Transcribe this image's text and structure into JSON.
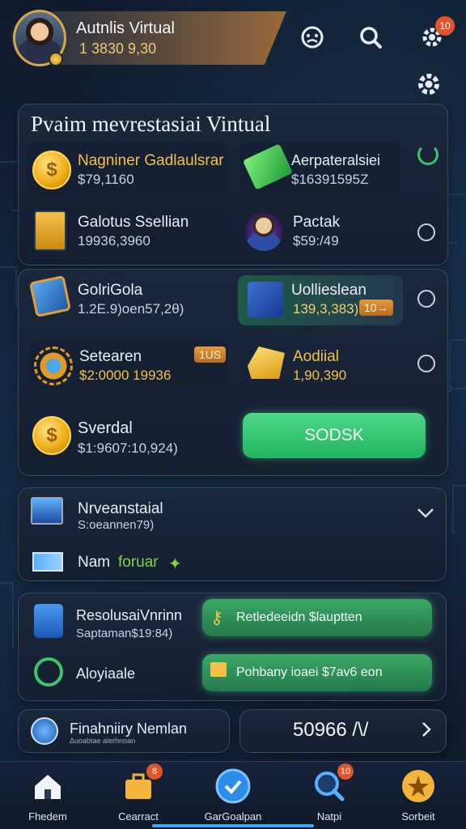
{
  "header": {
    "profile_name": "Autnlis Virtual",
    "profile_balance": "1 3830 9,30",
    "notification_count": "10"
  },
  "main_panel": {
    "title": "Pvaim mevrestasiai Vintual",
    "tiles": [
      {
        "label": "Nagniner Gadlaulsrar",
        "value": "$79,1160"
      },
      {
        "label": "Aerpateralsiei",
        "value": "$16391595Ζ"
      },
      {
        "label": "Galotus Ssellian",
        "value": "19936,3960"
      },
      {
        "label": "Pactak",
        "value": "$59:/49"
      }
    ]
  },
  "wallet_panel": {
    "tiles": [
      {
        "label": "GolriGola",
        "value": "1.2Ε.9)oen57,2θ)"
      },
      {
        "label": "Uollieslean",
        "value": "139,3,383)",
        "badge": "10→"
      },
      {
        "label": "Setearen",
        "value": "$2:0000 19936",
        "badge": "1US"
      },
      {
        "label": "Aodiial",
        "value": "1,90,390"
      },
      {
        "label": "Sverdal",
        "value": "$1:9607:10,924)"
      }
    ],
    "action_button": "SODSK"
  },
  "invest_panel": {
    "title": "Nrveanstaial",
    "subtitle": "S:oeannen79)",
    "row_label": "Nam",
    "row_accent": "foruar"
  },
  "reward_panel": {
    "row1_label": "ResolusaiVnrinn",
    "row1_sub": "Saptaman$19:84)",
    "row1_button": "Retledeeidn $lauptten",
    "row2_label": "Aloyiaale",
    "row2_button": "Pohbany ioaei $7av6 eon"
  },
  "footer_row": {
    "left_title": "Finahniiry Nemlan",
    "left_sub": "Δuoabtae alerhnoan",
    "right_value": "50966 /\\/"
  },
  "bottom_nav": {
    "items": [
      {
        "label": "Fhedem",
        "icon": "home-icon"
      },
      {
        "label": "Cearract",
        "icon": "toolbox-icon",
        "badge": "8"
      },
      {
        "label": "GarGoalpan",
        "icon": "check-circle-icon"
      },
      {
        "label": "Natpi",
        "icon": "search-icon",
        "badge": "10"
      },
      {
        "label": "Sorbeit",
        "icon": "star-icon"
      }
    ]
  }
}
